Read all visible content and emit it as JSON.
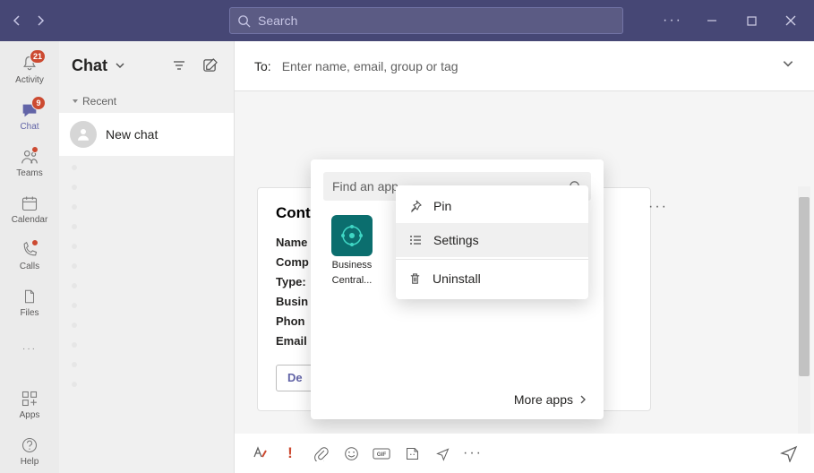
{
  "titlebar": {
    "search_placeholder": "Search"
  },
  "rail": {
    "activity": {
      "label": "Activity",
      "badge": "21"
    },
    "chat": {
      "label": "Chat",
      "badge": "9"
    },
    "teams": {
      "label": "Teams"
    },
    "calendar": {
      "label": "Calendar"
    },
    "calls": {
      "label": "Calls"
    },
    "files": {
      "label": "Files"
    },
    "apps": {
      "label": "Apps"
    },
    "help": {
      "label": "Help"
    }
  },
  "chatPanel": {
    "title": "Chat",
    "recent_label": "Recent",
    "new_chat_label": "New chat"
  },
  "conv": {
    "to_label": "To:",
    "to_placeholder": "Enter name, email, group or tag"
  },
  "card": {
    "title": "Cont",
    "lines": [
      "Name",
      "Comp",
      "Type:",
      "Busin",
      "Phon",
      "Email"
    ],
    "button": "De"
  },
  "flyout": {
    "find_placeholder": "Find an app",
    "app_label_line1": "Business",
    "app_label_line2": "Central...",
    "more_apps": "More apps"
  },
  "ctx": {
    "pin": "Pin",
    "settings": "Settings",
    "uninstall": "Uninstall"
  }
}
